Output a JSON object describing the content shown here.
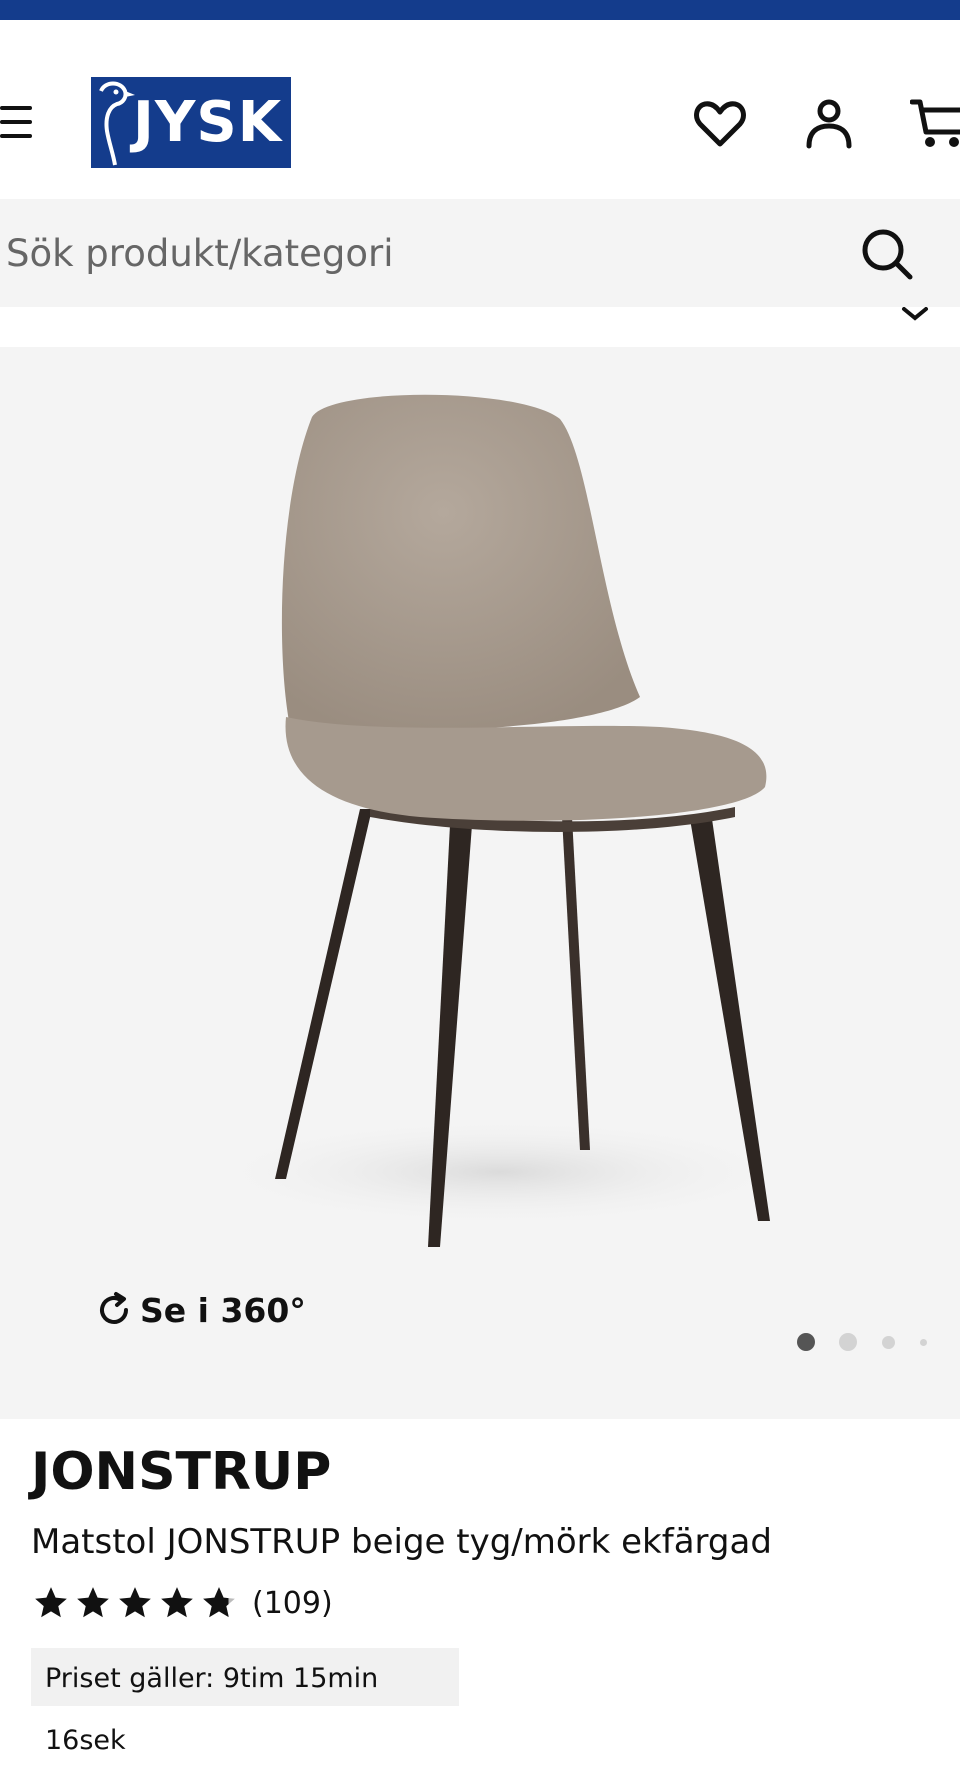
{
  "header": {
    "logo_text": "JYSK",
    "icons": [
      "menu-icon",
      "heart-icon",
      "user-icon",
      "cart-icon"
    ]
  },
  "search": {
    "placeholder": "Sök produkt/kategori"
  },
  "gallery": {
    "view360_label": "Se i 360°",
    "slide_count": 4,
    "active_slide": 1
  },
  "product": {
    "name": "JONSTRUP",
    "description": "Matstol JONSTRUP beige tyg/mörk ekfärgad",
    "rating": 4.7,
    "review_count": "(109)",
    "price_timer": "Priset gäller: 9tim 15min 16sek"
  },
  "colors": {
    "brand_blue": "#143c8c",
    "gallery_bg": "#f4f4f4"
  }
}
